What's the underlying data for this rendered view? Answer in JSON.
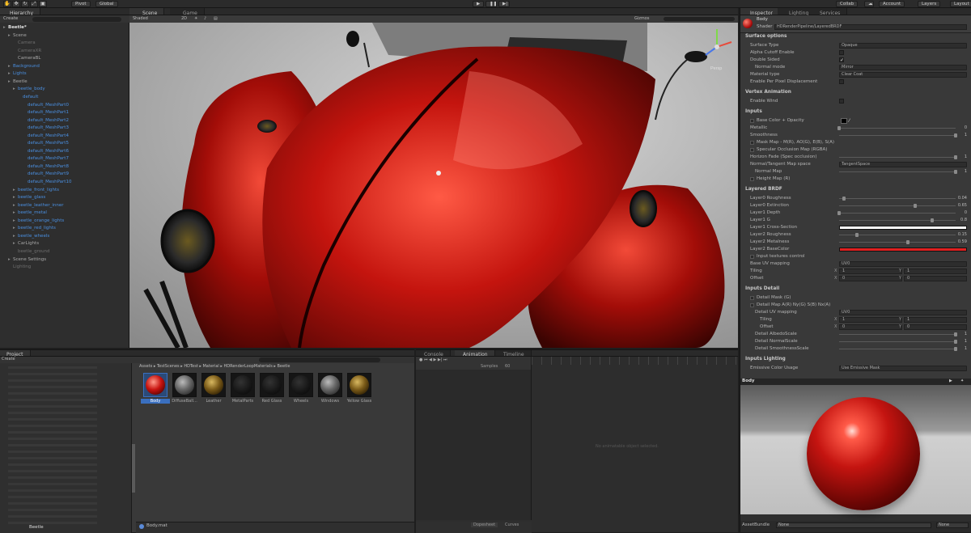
{
  "toolbar": {
    "pivot": "Pivot",
    "global": "Global",
    "collab": "Collab",
    "account": "Account",
    "layers": "Layers",
    "layout": "Layout"
  },
  "hierarchy": {
    "tab": "Hierarchy",
    "create": "Create",
    "items": [
      {
        "label": "Beetle*",
        "indent": 0,
        "style": "root"
      },
      {
        "label": "Scene",
        "indent": 1,
        "style": "normal"
      },
      {
        "label": "Camera",
        "indent": 2,
        "style": "dim"
      },
      {
        "label": "CameraXR",
        "indent": 2,
        "style": "dim"
      },
      {
        "label": "CameraBL",
        "indent": 2,
        "style": "normal"
      },
      {
        "label": "Background",
        "indent": 1,
        "style": "blue"
      },
      {
        "label": "Lights",
        "indent": 1,
        "style": "blue"
      },
      {
        "label": "Beetle",
        "indent": 1,
        "style": "normal"
      },
      {
        "label": "beetle_body",
        "indent": 2,
        "style": "blue"
      },
      {
        "label": "default",
        "indent": 3,
        "style": "blue"
      },
      {
        "label": "default_MeshPart0",
        "indent": 4,
        "style": "blue"
      },
      {
        "label": "default_MeshPart1",
        "indent": 4,
        "style": "blue"
      },
      {
        "label": "default_MeshPart2",
        "indent": 4,
        "style": "blue"
      },
      {
        "label": "default_MeshPart3",
        "indent": 4,
        "style": "blue"
      },
      {
        "label": "default_MeshPart4",
        "indent": 4,
        "style": "blue"
      },
      {
        "label": "default_MeshPart5",
        "indent": 4,
        "style": "blue"
      },
      {
        "label": "default_MeshPart6",
        "indent": 4,
        "style": "blue"
      },
      {
        "label": "default_MeshPart7",
        "indent": 4,
        "style": "blue"
      },
      {
        "label": "default_MeshPart8",
        "indent": 4,
        "style": "blue"
      },
      {
        "label": "default_MeshPart9",
        "indent": 4,
        "style": "blue"
      },
      {
        "label": "default_MeshPart10",
        "indent": 4,
        "style": "blue"
      },
      {
        "label": "beetle_front_lights",
        "indent": 2,
        "style": "blue"
      },
      {
        "label": "beetle_glass",
        "indent": 2,
        "style": "blue"
      },
      {
        "label": "beetle_leather_inner",
        "indent": 2,
        "style": "blue"
      },
      {
        "label": "beetle_metal",
        "indent": 2,
        "style": "blue"
      },
      {
        "label": "beetle_orange_lights",
        "indent": 2,
        "style": "blue"
      },
      {
        "label": "beetle_red_lights",
        "indent": 2,
        "style": "blue"
      },
      {
        "label": "beetle_wheels",
        "indent": 2,
        "style": "blue"
      },
      {
        "label": "CarLights",
        "indent": 2,
        "style": "normal"
      },
      {
        "label": "beetle_ground",
        "indent": 2,
        "style": "dim"
      },
      {
        "label": "Scene Settings",
        "indent": 1,
        "style": "normal"
      },
      {
        "label": "Lighting",
        "indent": 1,
        "style": "dim"
      }
    ]
  },
  "scene": {
    "tab_scene": "Scene",
    "tab_game": "Game",
    "shading": "Shaded",
    "mode_2d": "2D",
    "gizmos": "Gizmos",
    "persp": "Persp"
  },
  "project": {
    "tab": "Project",
    "create": "Create",
    "breadcrumb": "Assets ▸ TestScenes ▸ HDTest ▸ Material ▸ HDRenderLoopMaterials ▸ Beetle",
    "assets": [
      {
        "label": "Body",
        "kind": "red"
      },
      {
        "label": "DiffuseBall...",
        "kind": "grey"
      },
      {
        "label": "Leather",
        "kind": "gold"
      },
      {
        "label": "MetalParts",
        "kind": "dark"
      },
      {
        "label": "Red Glass",
        "kind": "dark"
      },
      {
        "label": "Wheels",
        "kind": "dark"
      },
      {
        "label": "Windows",
        "kind": "grey"
      },
      {
        "label": "Yellow Glass",
        "kind": "gold"
      }
    ],
    "footer_file": "Body.mat"
  },
  "animation": {
    "tab_console": "Console",
    "tab_animation": "Animation",
    "tab_timeline": "Timeline",
    "samples": "Samples",
    "samples_value": "60",
    "empty_message": "No animatable object selected.",
    "dopesheet": "Dopesheet",
    "curves": "Curves"
  },
  "inspector": {
    "tab_inspector": "Inspector",
    "tab_lighting": "Lighting",
    "tab_services": "Services",
    "material_name": "Body",
    "shader_label": "Shader",
    "shader_value": "HDRenderPipeline/LayeredBRDF",
    "rows": [
      {
        "type": "section",
        "label": "Surface options"
      },
      {
        "type": "field",
        "label": "Surface Type",
        "value": "Opaque"
      },
      {
        "type": "check",
        "label": "Alpha Cutoff Enable",
        "checked": false
      },
      {
        "type": "check",
        "label": "Double Sided",
        "checked": true
      },
      {
        "type": "field",
        "label": "Normal mode",
        "value": "Mirror",
        "indent": 1
      },
      {
        "type": "field",
        "label": "Material type",
        "value": "Clear Coat"
      },
      {
        "type": "check",
        "label": "Enable Per Pixel Displacement",
        "checked": false
      },
      {
        "type": "section",
        "label": "Vertex Animation"
      },
      {
        "type": "check",
        "label": "Enable Wind",
        "checked": false
      },
      {
        "type": "section",
        "label": "Inputs"
      },
      {
        "type": "color",
        "label": "Base Color + Opacity",
        "swatch": "#000000"
      },
      {
        "type": "slider",
        "label": "Metallic",
        "value": "0",
        "fraction": 0.0
      },
      {
        "type": "slider",
        "label": "Smoothness",
        "value": "1",
        "fraction": 1.0
      },
      {
        "type": "text",
        "label": "Mask Map - M(R), AO(G), E(B), S(A)"
      },
      {
        "type": "text",
        "label": "Specular Occlusion Map (RGBA)"
      },
      {
        "type": "slider",
        "label": "Horizon Fade (Spec occlusion)",
        "value": "1",
        "fraction": 1.0
      },
      {
        "type": "field",
        "label": "Normal/Tangent Map space",
        "value": "TangentSpace"
      },
      {
        "type": "slider",
        "label": "Normal Map",
        "value": "1",
        "fraction": 1.0,
        "indent": 1
      },
      {
        "type": "text",
        "label": "Height Map (R)"
      },
      {
        "type": "section",
        "label": "Layered BRDF"
      },
      {
        "type": "slider",
        "label": "Layer0 Roughness",
        "value": "0.04",
        "fraction": 0.04
      },
      {
        "type": "slider",
        "label": "Layer0 Extinction",
        "value": "0.65",
        "fraction": 0.65
      },
      {
        "type": "slider",
        "label": "Layer1 Depth",
        "value": "0",
        "fraction": 0.0
      },
      {
        "type": "slider",
        "label": "Layer1 G",
        "value": "0.8",
        "fraction": 0.8
      },
      {
        "type": "color",
        "label": "Layer1 Cross-Section",
        "swatch": "#ffffff",
        "wide": true
      },
      {
        "type": "slider",
        "label": "Layer2 Roughness",
        "value": "0.15",
        "fraction": 0.15
      },
      {
        "type": "slider",
        "label": "Layer2 Metalness",
        "value": "0.59",
        "fraction": 0.59
      },
      {
        "type": "color",
        "label": "Layer2 BaseColor",
        "swatch": "#e02020",
        "wide": true
      },
      {
        "type": "text",
        "label": "Input textures control"
      },
      {
        "type": "field",
        "label": "Base UV mapping",
        "value": "UV0"
      },
      {
        "type": "xy",
        "label": "Tiling",
        "x": "1",
        "y": "1"
      },
      {
        "type": "xy",
        "label": "Offset",
        "x": "0",
        "y": "0"
      },
      {
        "type": "section",
        "label": "Inputs Detail"
      },
      {
        "type": "text",
        "label": "Detail Mask (G)"
      },
      {
        "type": "text",
        "label": "Detail Map A(R) Ny(G) S(B) Nx(A)"
      },
      {
        "type": "field",
        "label": "Detail UV mapping",
        "value": "UV0",
        "indent": 1
      },
      {
        "type": "xy",
        "label": "Tiling",
        "x": "1",
        "y": "1",
        "indent": 2
      },
      {
        "type": "xy",
        "label": "Offset",
        "x": "0",
        "y": "0",
        "indent": 2
      },
      {
        "type": "slider",
        "label": "Detail AlbedoScale",
        "value": "1",
        "fraction": 1.0,
        "indent": 1
      },
      {
        "type": "slider",
        "label": "Detail NormalScale",
        "value": "1",
        "fraction": 1.0,
        "indent": 1
      },
      {
        "type": "slider",
        "label": "Detail SmoothnessScale",
        "value": "1",
        "fraction": 1.0,
        "indent": 1
      },
      {
        "type": "section",
        "label": "Inputs Lighting"
      },
      {
        "type": "field",
        "label": "Emissive Color Usage",
        "value": "Use Emissive Mask"
      }
    ],
    "preview_title": "Body",
    "assetbundle_label": "AssetBundle",
    "assetbundle_value": "None",
    "assetbundle_variant": "None"
  }
}
